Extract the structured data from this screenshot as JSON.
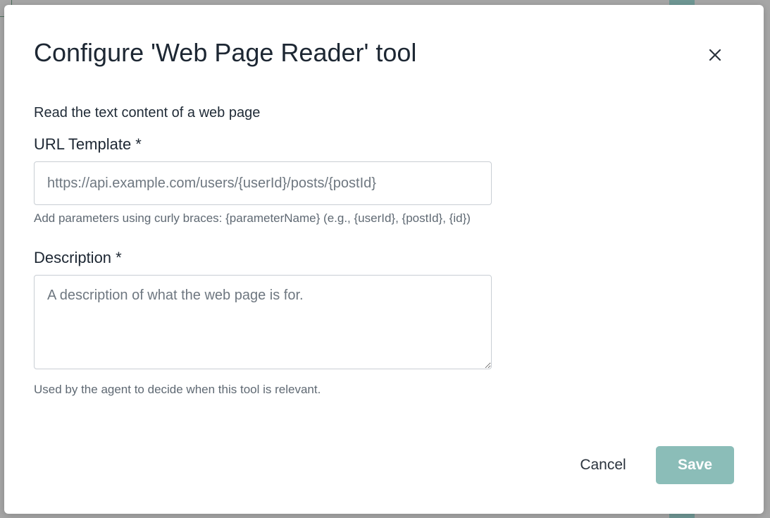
{
  "dialog": {
    "title": "Configure 'Web Page Reader' tool",
    "subtitle": "Read the text content of a web page",
    "close_icon": "close-icon"
  },
  "url_field": {
    "label": "URL Template *",
    "value": "",
    "placeholder": "https://api.example.com/users/{userId}/posts/{postId}",
    "helper": "Add parameters using curly braces: {parameterName} (e.g., {userId}, {postId}, {id})"
  },
  "description_field": {
    "label": "Description *",
    "value": "",
    "placeholder": "A description of what the web page is for.",
    "helper": "Used by the agent to decide when this tool is relevant."
  },
  "actions": {
    "cancel_label": "Cancel",
    "save_label": "Save"
  },
  "colors": {
    "primary_disabled": "#8bbdb8",
    "title_text": "#1d2733",
    "helper_text": "#5f6973",
    "overlay": "#a6a6a6"
  }
}
